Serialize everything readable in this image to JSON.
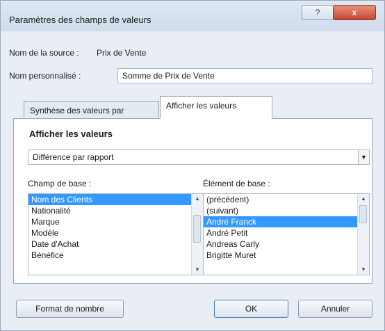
{
  "window": {
    "title": "Paramètres des champs de valeurs",
    "help_label": "?",
    "close_label": "x"
  },
  "source": {
    "label": "Nom de la source :",
    "value": "Prix de Vente"
  },
  "custom_name": {
    "label": "Nom personnalisé :",
    "value": "Somme de Prix de Vente"
  },
  "tabs": [
    {
      "label": "Synthèse des valeurs par",
      "active": false
    },
    {
      "label": "Afficher les valeurs",
      "active": true
    }
  ],
  "panel": {
    "section_title": "Afficher les valeurs",
    "show_as_value": "Différence par rapport",
    "base_field_label": "Champ de base :",
    "base_item_label": "Élément de base :",
    "base_fields": [
      {
        "label": "Nom des Clients",
        "selected": true
      },
      {
        "label": "Nationalité",
        "selected": false
      },
      {
        "label": "Marque",
        "selected": false
      },
      {
        "label": "Modèle",
        "selected": false
      },
      {
        "label": "Date d'Achat",
        "selected": false
      },
      {
        "label": "Bénéfice",
        "selected": false
      }
    ],
    "base_items": [
      {
        "label": "(précédent)",
        "selected": false
      },
      {
        "label": "(suivant)",
        "selected": false
      },
      {
        "label": "André Franck",
        "selected": true
      },
      {
        "label": "André Petit",
        "selected": false
      },
      {
        "label": "Andreas Carly",
        "selected": false
      },
      {
        "label": "Brigitte Muret",
        "selected": false
      }
    ]
  },
  "buttons": {
    "number_format": "Format de nombre",
    "ok": "OK",
    "cancel": "Annuler"
  },
  "colors": {
    "selection": "#3399ff",
    "close_button": "#c9452f"
  },
  "icons": {
    "dropdown": "chevron-down-icon",
    "scroll_up": "arrow-up-icon",
    "scroll_down": "arrow-down-icon"
  }
}
